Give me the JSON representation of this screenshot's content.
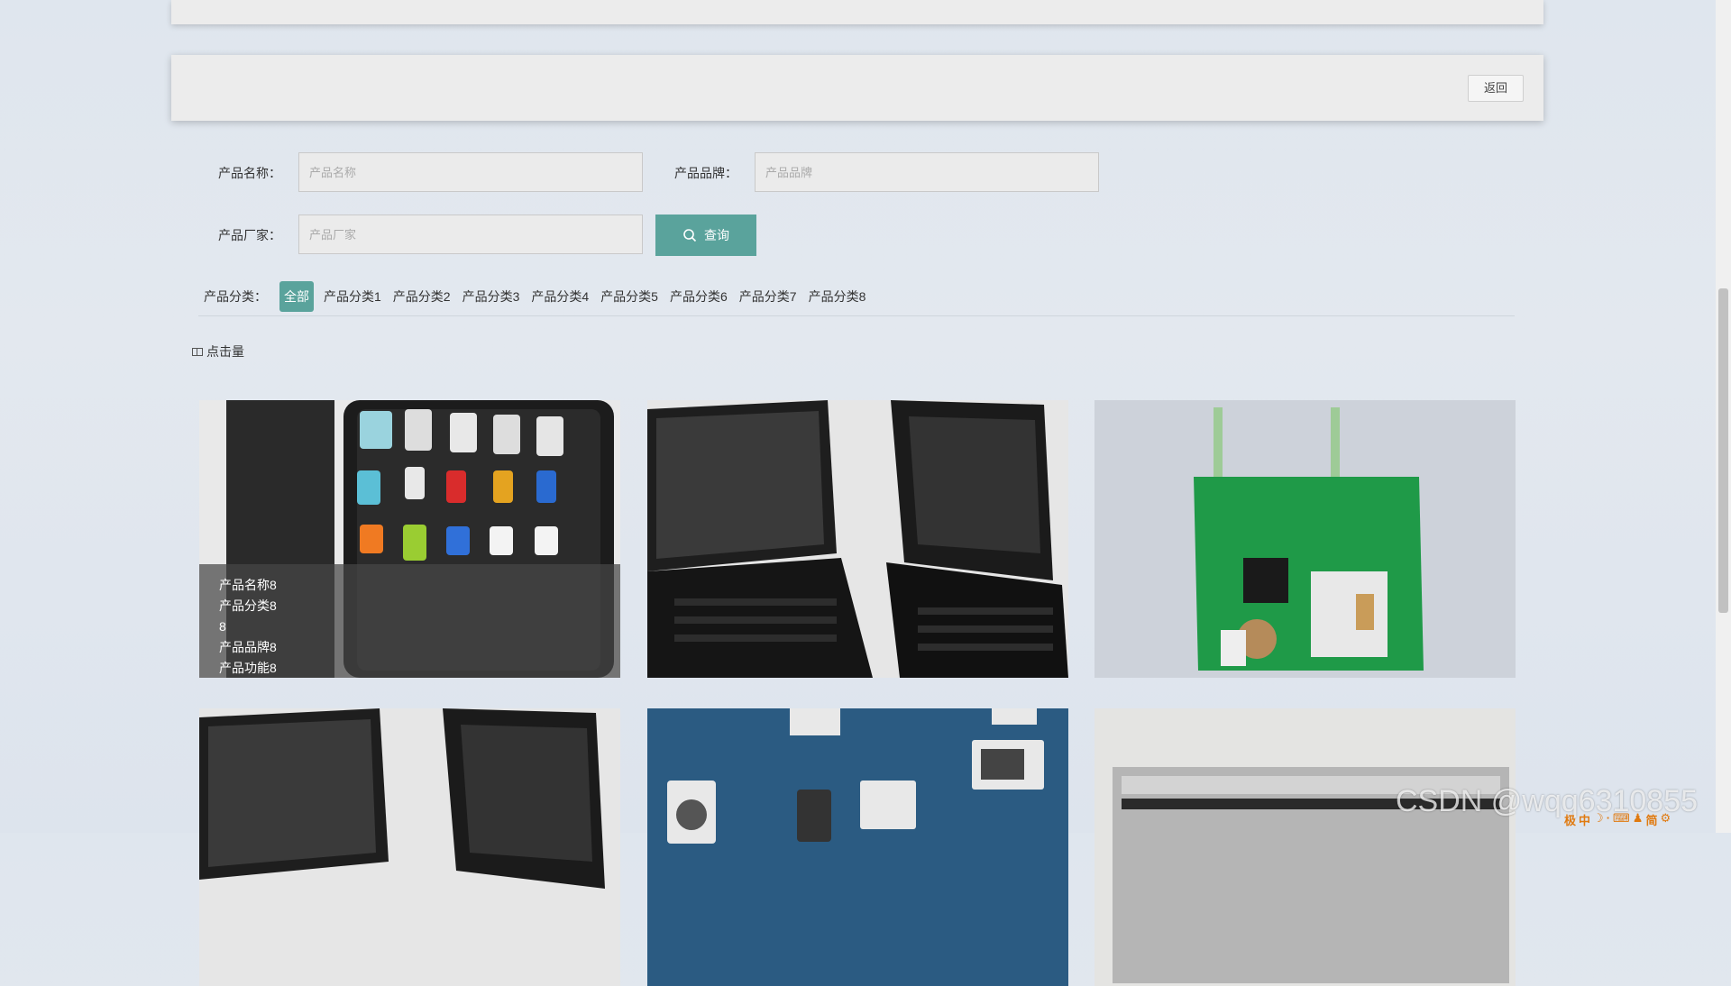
{
  "header_panel": {
    "back_label": "返回"
  },
  "filters": {
    "name_label": "产品名称：",
    "name_placeholder": "产品名称",
    "brand_label": "产品品牌：",
    "brand_placeholder": "产品品牌",
    "maker_label": "产品厂家：",
    "maker_placeholder": "产品厂家",
    "search_label": "查询"
  },
  "categories": {
    "label": "产品分类：",
    "items": [
      "全部",
      "产品分类1",
      "产品分类2",
      "产品分类3",
      "产品分类4",
      "产品分类5",
      "产品分类6",
      "产品分类7",
      "产品分类8"
    ],
    "active_index": 0
  },
  "sort": {
    "label": "点击量"
  },
  "products": [
    {
      "image": "usb-case-photo",
      "overlay": {
        "name": "产品名称8",
        "category": "产品分类8",
        "extra": "8",
        "brand": "产品品牌8",
        "function": "产品功能8"
      }
    },
    {
      "image": "laptops-photo"
    },
    {
      "image": "circuit-board-photo"
    },
    {
      "image": "laptops-photo"
    },
    {
      "image": "smart-home-diagram"
    },
    {
      "image": "ionizing-blower-photo"
    }
  ],
  "watermark": "CSDN @wqq6310855",
  "ime_toolbar": [
    "极",
    "中",
    "☽",
    "·",
    "⌨",
    "♟",
    "简",
    "⚙"
  ],
  "colors": {
    "accent": "#5aa39c",
    "panel": "#ececec",
    "background": "#e0e6ee"
  }
}
